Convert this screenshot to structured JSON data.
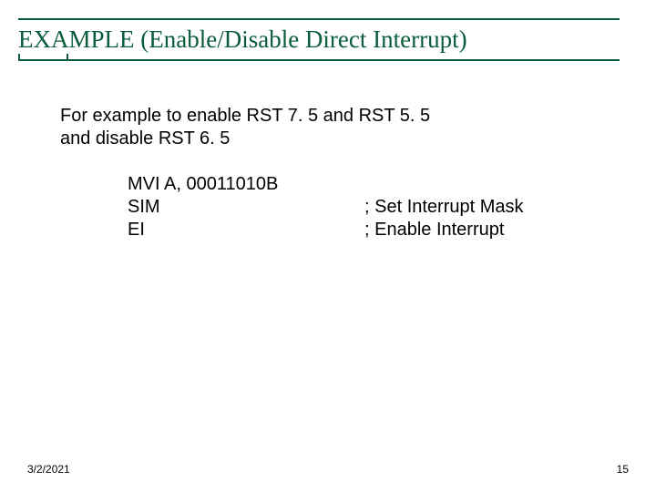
{
  "title": "EXAMPLE (Enable/Disable Direct Interrupt)",
  "intro_line1": "For example to enable RST 7. 5 and RST 5. 5",
  "intro_line2": "and disable RST 6. 5",
  "code": {
    "r1_inst": "MVI A, 00011010B",
    "r1_cmt": "",
    "r2_inst": "SIM",
    "r2_cmt": "; Set Interrupt Mask",
    "r3_inst": "EI",
    "r3_cmt": "; Enable Interrupt"
  },
  "footer": {
    "date": "3/2/2021",
    "page": "15"
  },
  "colors": {
    "accent": "#0a5d3a"
  }
}
